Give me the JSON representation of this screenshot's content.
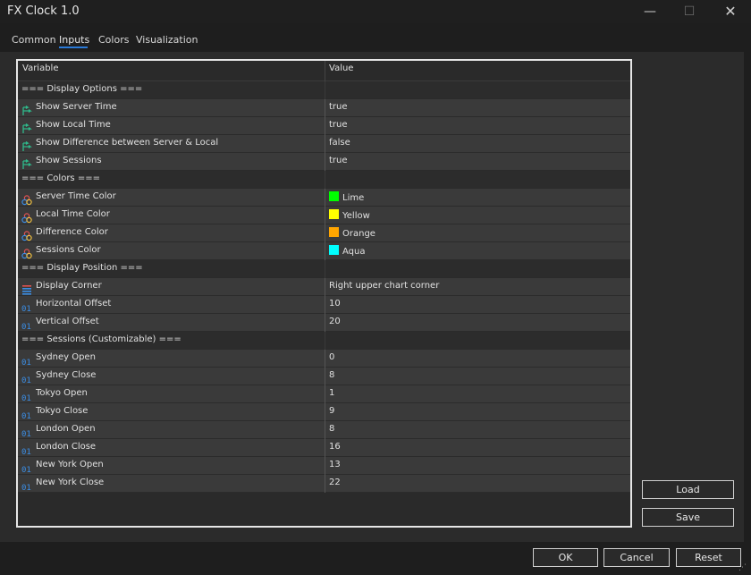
{
  "window": {
    "title": "FX Clock 1.0",
    "minimize_glyph": "—",
    "maximize_glyph": "☐",
    "close_glyph": "✕"
  },
  "tabs": [
    {
      "label": "Common",
      "active": false
    },
    {
      "label": "Inputs",
      "active": true
    },
    {
      "label": "Colors",
      "active": false
    },
    {
      "label": "Visualization",
      "active": false
    }
  ],
  "table": {
    "headers": {
      "variable": "Variable",
      "value": "Value"
    },
    "rows": [
      {
        "kind": "section",
        "name": "=== Display Options ===",
        "value": ""
      },
      {
        "kind": "bool",
        "icon": "boolean-icon",
        "name": "Show Server Time",
        "value": "true"
      },
      {
        "kind": "bool",
        "icon": "boolean-icon",
        "name": "Show Local Time",
        "value": "true"
      },
      {
        "kind": "bool",
        "icon": "boolean-icon",
        "name": "Show Difference between Server & Local",
        "value": "false"
      },
      {
        "kind": "bool",
        "icon": "boolean-icon",
        "name": "Show Sessions",
        "value": "true"
      },
      {
        "kind": "section",
        "name": "=== Colors ===",
        "value": ""
      },
      {
        "kind": "color",
        "icon": "color-icon",
        "name": "Server Time Color",
        "value": "Lime",
        "swatch": "#00ff00"
      },
      {
        "kind": "color",
        "icon": "color-icon",
        "name": "Local Time Color",
        "value": "Yellow",
        "swatch": "#ffff00"
      },
      {
        "kind": "color",
        "icon": "color-icon",
        "name": "Difference Color",
        "value": "Orange",
        "swatch": "#ffa500"
      },
      {
        "kind": "color",
        "icon": "color-icon",
        "name": "Sessions Color",
        "value": "Aqua",
        "swatch": "#00ffff"
      },
      {
        "kind": "section",
        "name": "=== Display Position ===",
        "value": ""
      },
      {
        "kind": "enum",
        "icon": "enum-icon",
        "name": "Display Corner",
        "value": "Right upper chart corner"
      },
      {
        "kind": "int",
        "icon": "integer-icon",
        "name": "Horizontal Offset",
        "value": "10"
      },
      {
        "kind": "int",
        "icon": "integer-icon",
        "name": "Vertical Offset",
        "value": "20"
      },
      {
        "kind": "section",
        "name": "=== Sessions (Customizable) ===",
        "value": ""
      },
      {
        "kind": "int",
        "icon": "integer-icon",
        "name": "Sydney Open",
        "value": "0"
      },
      {
        "kind": "int",
        "icon": "integer-icon",
        "name": "Sydney Close",
        "value": "8"
      },
      {
        "kind": "int",
        "icon": "integer-icon",
        "name": "Tokyo Open",
        "value": "1"
      },
      {
        "kind": "int",
        "icon": "integer-icon",
        "name": "Tokyo Close",
        "value": "9"
      },
      {
        "kind": "int",
        "icon": "integer-icon",
        "name": "London Open",
        "value": "8"
      },
      {
        "kind": "int",
        "icon": "integer-icon",
        "name": "London Close",
        "value": "16"
      },
      {
        "kind": "int",
        "icon": "integer-icon",
        "name": "New York Open",
        "value": "13"
      },
      {
        "kind": "int",
        "icon": "integer-icon",
        "name": "New York Close",
        "value": "22"
      }
    ]
  },
  "side_buttons": {
    "load": "Load",
    "save": "Save"
  },
  "footer_buttons": {
    "ok": "OK",
    "cancel": "Cancel",
    "reset": "Reset"
  },
  "colors": {
    "accent": "#2a7ad8",
    "bool_icon": "#2fb98a",
    "int_icon": "#3a8ee6"
  }
}
